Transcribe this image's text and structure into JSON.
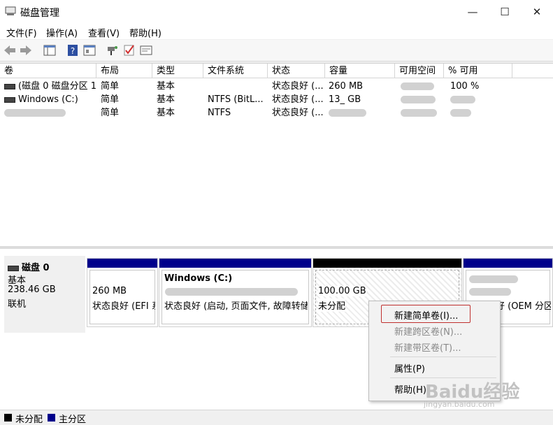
{
  "window": {
    "title": "磁盘管理",
    "minimize": "—",
    "maximize": "☐",
    "close": "✕"
  },
  "menu": [
    "文件(F)",
    "操作(A)",
    "查看(V)",
    "帮助(H)"
  ],
  "toolbar": {
    "icons": [
      "back-arrow-icon",
      "forward-arrow-icon",
      "console-tree-icon",
      "help-icon",
      "properties-icon",
      "connect-icon",
      "check-icon",
      "window-icon"
    ]
  },
  "volume_table": {
    "headers": [
      "卷",
      "布局",
      "类型",
      "文件系统",
      "状态",
      "容量",
      "可用空间",
      "% 可用"
    ],
    "rows": [
      {
        "volume": "(磁盘 0 磁盘分区 1)",
        "layout": "简单",
        "type": "基本",
        "fs": "",
        "status": "状态良好 (...",
        "capacity": "260 MB",
        "free": "",
        "pct": "100 %"
      },
      {
        "volume": "Windows (C:)",
        "layout": "简单",
        "type": "基本",
        "fs": "NTFS (BitL...",
        "status": "状态良好 (...",
        "capacity": "13_ GB",
        "free": "",
        "pct": ""
      },
      {
        "volume": "",
        "layout": "简单",
        "type": "基本",
        "fs": "NTFS",
        "status": "状态良好 (...",
        "capacity": "",
        "free": "",
        "pct": ""
      }
    ]
  },
  "disk": {
    "name": "磁盘 0",
    "type": "基本",
    "size": "238.46 GB",
    "state": "联机"
  },
  "partitions": [
    {
      "title": "",
      "size": "260 MB",
      "status": "状态良好 (EFI 系"
    },
    {
      "title": "Windows (C:)",
      "size": "",
      "status": "状态良好 (启动, 页面文件, 故障转储,"
    },
    {
      "title": "",
      "size": "100.00 GB",
      "status": "未分配"
    },
    {
      "title": "",
      "size": "",
      "status": "状态良好 (OEM 分区"
    }
  ],
  "context_menu": {
    "items": [
      {
        "label": "新建简单卷(I)...",
        "enabled": true
      },
      {
        "label": "新建跨区卷(N)...",
        "enabled": false
      },
      {
        "label": "新建带区卷(T)...",
        "enabled": false
      },
      {
        "label": "属性(P)",
        "enabled": true
      },
      {
        "label": "帮助(H)",
        "enabled": true
      }
    ]
  },
  "legend": [
    {
      "label": "未分配",
      "color": "#000000"
    },
    {
      "label": "主分区",
      "color": "#00008b"
    }
  ],
  "watermark": {
    "main": "Baidu经验",
    "sub": "jingyan.baidu.com"
  },
  "colors": {
    "primary_partition": "#00008b",
    "unallocated": "#000000",
    "highlight": "#c0302e"
  }
}
